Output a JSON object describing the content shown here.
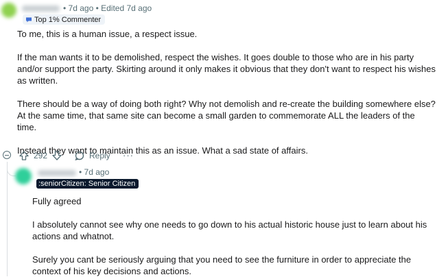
{
  "comment1": {
    "username": "QuietWaves",
    "time": "7d ago",
    "edited": "Edited 7d ago",
    "badge": "Top 1% Commenter",
    "paragraphs": [
      "To me, this is a human issue, a respect issue.",
      "If the man wants it to be demolished, respect the wishes. It goes double to those who are in his party and/or support the party. Skirting around it only makes it obvious that they don't want to respect his wishes as written.",
      "There should be a way of doing both right? Why not demolish and re-create the building somewhere else? At the same time, that same site can become a small garden to commemorate ALL the leaders of the time.",
      "Instead they want to maintain this as an issue. What a sad state of affairs."
    ],
    "vote_count": "292",
    "reply_label": "Reply",
    "more_label": "···"
  },
  "comment2": {
    "username": "Coffeesince",
    "time": "7d ago",
    "flair": ":seniorCitizen: Senior Citizen",
    "paragraphs": [
      "Fully agreed",
      "I absolutely cannot see why one needs to go down to his actual historic house just to learn about his actions and whatnot.",
      "Surely you cant be seriously arguing that you need to see the furniture in order to appreciate the context of his key decisions and actions."
    ]
  },
  "colors": {
    "avatar1": "#8fd14f",
    "avatar2": "#2fcf9a",
    "flair_bg": "#0b1a2e",
    "badge_bg": "#eef3f8"
  }
}
